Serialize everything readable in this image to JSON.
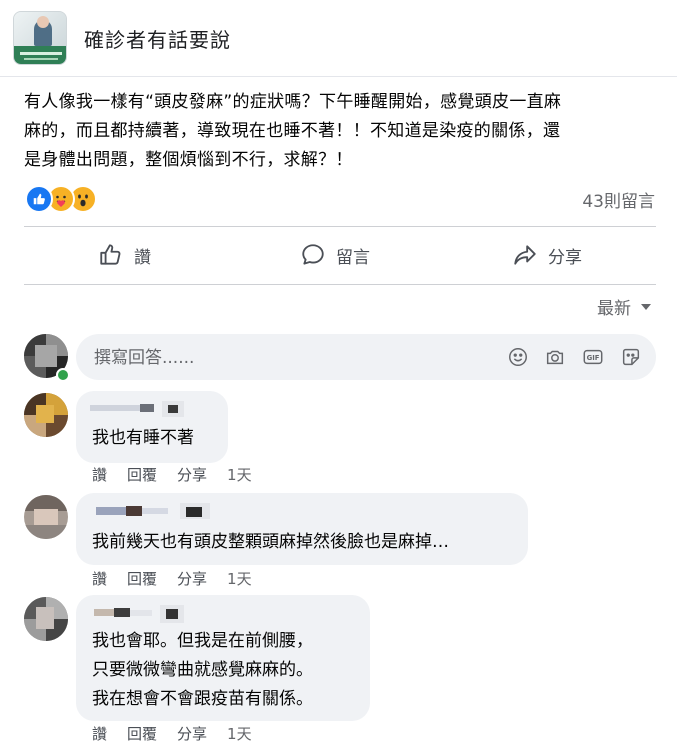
{
  "group": {
    "name": "確診者有話要說"
  },
  "post": {
    "lines": [
      "有人像我一樣有“頭皮發麻”的症狀嗎？下午睡醒開始，感覺頭皮一直麻",
      "麻的，而且都持續著，導致現在也睡不著！！不知道是染疫的關係，還",
      "是身體出問題，整個煩惱到不行，求解？！"
    ],
    "reactions": [
      "like-icon",
      "care-icon",
      "wow-icon"
    ],
    "comment_count": "43則留言"
  },
  "actions": {
    "like": "讚",
    "comment": "留言",
    "share": "分享"
  },
  "sort": {
    "label": "最新"
  },
  "composer": {
    "placeholder": "撰寫回答......"
  },
  "comments": [
    {
      "lines": [
        "我也有睡不著"
      ],
      "like": "讚",
      "reply": "回覆",
      "share": "分享",
      "time": "1天"
    },
    {
      "lines": [
        "我前幾天也有頭皮整顆頭麻掉然後臉也是麻掉…"
      ],
      "like": "讚",
      "reply": "回覆",
      "share": "分享",
      "time": "1天"
    },
    {
      "lines": [
        "我也會耶。但我是在前側腰，",
        "只要微微彎曲就感覺麻麻的。",
        "我在想會不會跟疫苗有關係。"
      ],
      "like": "讚",
      "reply": "回覆",
      "share": "分享",
      "time": "1天"
    }
  ],
  "colors": {
    "like_blue": "#1877f2",
    "reaction_yellow": "#f7b125",
    "bubble_bg": "#f0f2f5",
    "meta_text": "#65676b"
  }
}
